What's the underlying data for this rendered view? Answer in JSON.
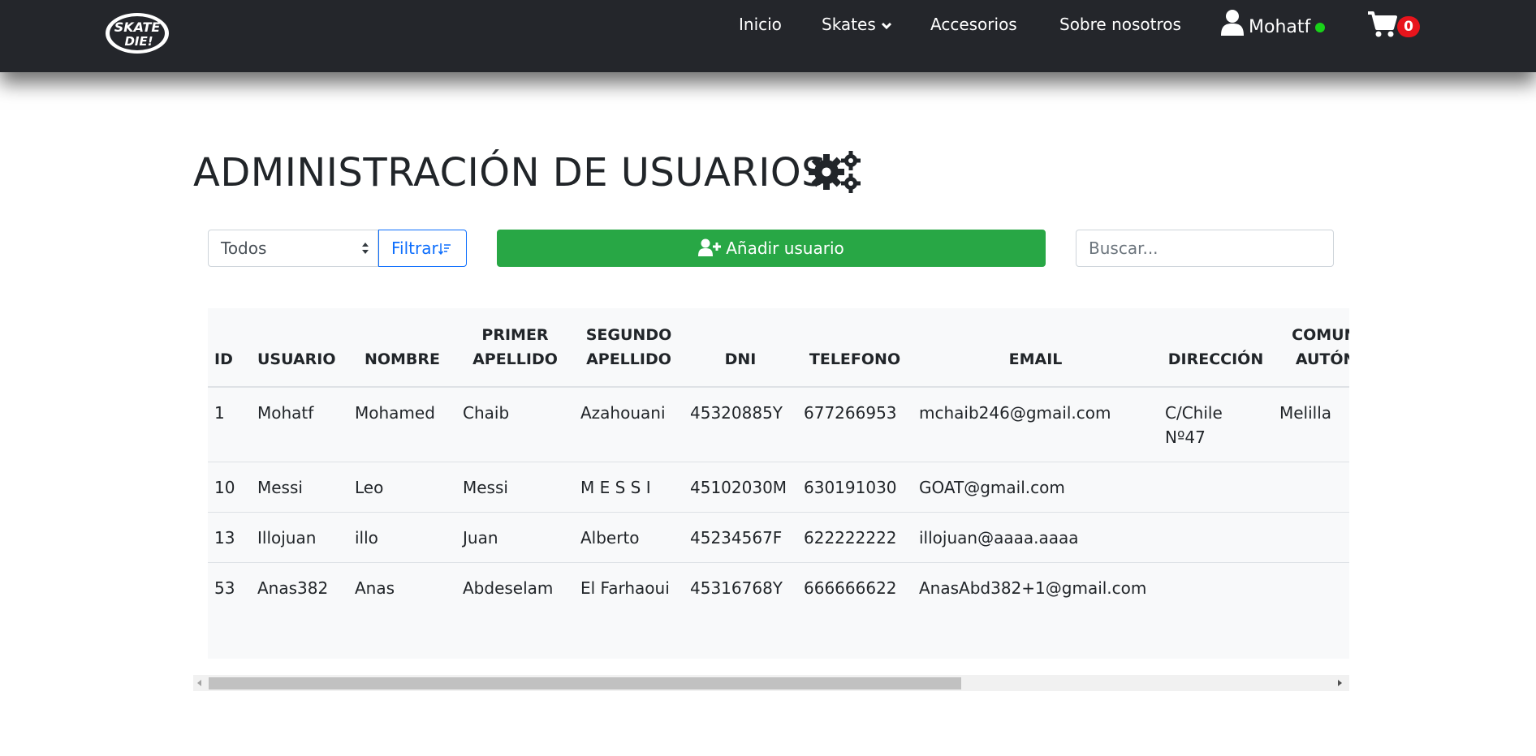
{
  "navbar": {
    "logo_text": "SKATE OR DIE!",
    "items": [
      {
        "label": "Inicio"
      },
      {
        "label": "Skates"
      },
      {
        "label": "Accesorios"
      },
      {
        "label": "Sobre nosotros"
      }
    ],
    "user": {
      "name": "Mohatf",
      "status": "online",
      "status_color": "#19d219"
    },
    "cart": {
      "count": "0"
    }
  },
  "page": {
    "title": "ADMINISTRACIÓN DE USUARIOS"
  },
  "controls": {
    "filter_selected": "Todos",
    "filter_button": "Filtrar",
    "add_button": "Añadir usuario",
    "search_placeholder": "Buscar..."
  },
  "table": {
    "headers": [
      [
        "ID"
      ],
      [
        "USUARIO"
      ],
      [
        "NOMBRE"
      ],
      [
        "PRIMER",
        "APELLIDO"
      ],
      [
        "SEGUNDO",
        "APELLIDO"
      ],
      [
        "DNI"
      ],
      [
        "TELEFONO"
      ],
      [
        "EMAIL"
      ],
      [
        "DIRECCIÓN"
      ],
      [
        "COMUNIDAD",
        "AUTÓNOMA"
      ]
    ],
    "rows": [
      [
        "1",
        "Mohatf",
        "Mohamed",
        "Chaib",
        "Azahouani",
        "45320885Y",
        "677266953",
        "mchaib246@gmail.com",
        "C/Chile Nº47",
        "Melilla"
      ],
      [
        "10",
        "Messi",
        "Leo",
        "Messi",
        "M E S S I",
        "45102030M",
        "630191030",
        "GOAT@gmail.com",
        "",
        ""
      ],
      [
        "13",
        "Illojuan",
        "illo",
        "Juan",
        "Alberto",
        "45234567F",
        "622222222",
        "illojuan@aaaa.aaaa",
        "",
        ""
      ],
      [
        "53",
        "Anas382",
        "Anas",
        "Abdeselam",
        "El Farhaoui",
        "45316768Y",
        "666666622",
        "AnasAbd382+1@gmail.com",
        "",
        ""
      ]
    ]
  },
  "colors": {
    "navbar_bg": "#24262b",
    "add_button_bg": "#28a745",
    "filter_accent": "#0d6efd",
    "badge_bg": "#e8141c"
  },
  "icons": {
    "title": "gears-icon",
    "user": "user-icon",
    "cart": "shopping-cart-icon",
    "add": "user-plus-icon",
    "filter": "sort-filter-icon",
    "dropdown": "chevron-down-icon"
  }
}
